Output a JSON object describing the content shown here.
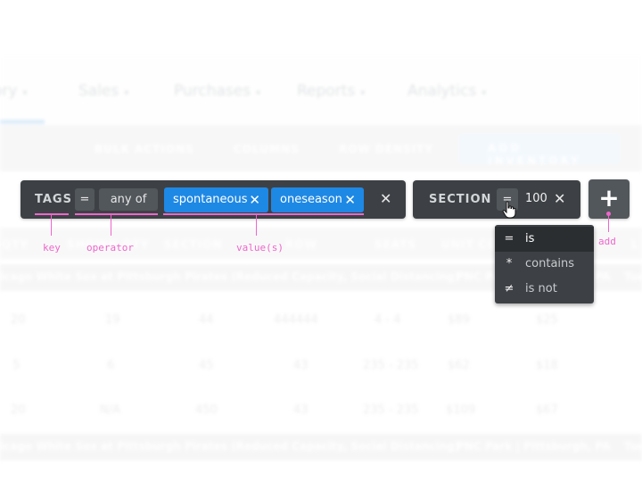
{
  "background": {
    "nav": [
      {
        "label": "ory"
      },
      {
        "label": "Sales"
      },
      {
        "label": "Purchases"
      },
      {
        "label": "Reports"
      },
      {
        "label": "Analytics"
      }
    ],
    "toolbar": {
      "bulk_actions": "BULK ACTIONS",
      "columns": "COLUMNS",
      "row_density": "ROW DENSITY",
      "add_inventory": "ADD INVENTORY"
    },
    "table_headers": [
      "QTY",
      "SHOWN QTY",
      "SECTION",
      "ROW",
      "SEATS",
      "UNIT CO",
      "L"
    ],
    "event_title": "icago White Sox at Pittsburgh Pirates (Reduced Capacity, Social Distancing)",
    "event_venue": "PNC Park | Pittsburgh, PA",
    "event_day": "Tue",
    "rows": [
      [
        "20",
        "19",
        "44",
        "444444",
        "4 - 4",
        "$89",
        "$25"
      ],
      [
        "5",
        "6",
        "45",
        "43",
        "235 - 235",
        "$62",
        "$18"
      ],
      [
        "20",
        "N/A",
        "450",
        "43",
        "235 - 235",
        "$109",
        "$67"
      ]
    ]
  },
  "filters": [
    {
      "key": "TAGS",
      "operator_symbol": "=",
      "operator_label": "any of",
      "values": [
        "spontaneous",
        "oneseason"
      ]
    },
    {
      "key": "SECTION",
      "operator_symbol": "=",
      "value": "100"
    }
  ],
  "add_button": "+",
  "operator_menu": [
    {
      "symbol": "=",
      "label": "is",
      "selected": true
    },
    {
      "symbol": "*",
      "label": "contains",
      "selected": false
    },
    {
      "symbol": "≠",
      "label": "is not",
      "selected": false
    }
  ],
  "annotations": {
    "key": "key",
    "operator": "operator",
    "values": "value(s)",
    "add": "add"
  },
  "icons": {
    "remove": "✕",
    "caret": "▾",
    "plus": "+"
  },
  "colors": {
    "chip_bg": "#3d4145",
    "value_chip": "#1e88e5",
    "annotation": "#ee66cc"
  }
}
